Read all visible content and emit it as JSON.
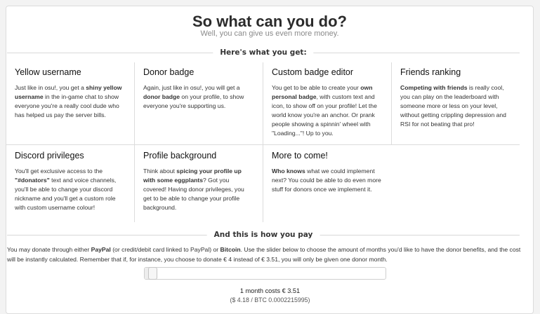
{
  "header": {
    "title": "So what can you do?",
    "subtitle": "Well, you can give us even more money."
  },
  "benefits_divider": "Here's what you get:",
  "benefits": [
    {
      "title": "Yellow username",
      "parts": [
        {
          "t": "Just like in osu!, you get a "
        },
        {
          "t": "shiny yellow username",
          "b": true
        },
        {
          "t": " in the in-game chat to show everyone you're a really cool dude who has helped us pay the server bills."
        }
      ]
    },
    {
      "title": "Donor badge",
      "parts": [
        {
          "t": "Again, just like in osu!, you will get a "
        },
        {
          "t": "donor badge",
          "b": true
        },
        {
          "t": " on your profile, to show everyone you're supporting us."
        }
      ]
    },
    {
      "title": "Custom badge editor",
      "parts": [
        {
          "t": "You get to be able to create your "
        },
        {
          "t": "own personal badge",
          "b": true
        },
        {
          "t": ", with custom text and icon, to show off on your profile! Let the world know you're an anchor. Or prank people showing a spinnin' wheel with \"Loading...\"! Up to you."
        }
      ]
    },
    {
      "title": "Friends ranking",
      "parts": [
        {
          "t": "Competing with friends",
          "b": true
        },
        {
          "t": " is really cool, you can play on the leaderboard with someone more or less on your level, without getting crippling depression and RSI for not beating that pro!"
        }
      ]
    },
    {
      "title": "Discord privileges",
      "parts": [
        {
          "t": "You'll get exclusive access to the "
        },
        {
          "t": "\"#donators\"",
          "b": true
        },
        {
          "t": " text and voice channels, you'll be able to change your discord nickname and you'll get a custom role with custom username colour!"
        }
      ]
    },
    {
      "title": "Profile background",
      "parts": [
        {
          "t": "Think about "
        },
        {
          "t": "spicing your profile up with some eggplants",
          "b": true
        },
        {
          "t": "? Got you covered! Having donor privileges, you get to be able to change your profile background."
        }
      ]
    },
    {
      "title": "More to come!",
      "parts": [
        {
          "t": "Who knows",
          "b": true
        },
        {
          "t": " what we could implement next? You could be able to do even more stuff for donors once we implement it."
        }
      ]
    }
  ],
  "payment_divider": "And this is how you pay",
  "payment": {
    "parts": [
      {
        "t": "You may donate through either "
      },
      {
        "t": "PayPal",
        "b": true
      },
      {
        "t": " (or credit/debit card linked to PayPal) or "
      },
      {
        "t": "Bitcoin",
        "b": true
      },
      {
        "t": ". Use the slider below to choose the amount of months you'd like to have the donor benefits, and the cost will be instantly calculated. Remember that if, for instance, you choose to donate € 4 instead of € 3.51, you will only be given one donor month."
      }
    ],
    "slider_value_fraction": 0.0,
    "cost_label": "1 month costs € 3.51",
    "rate_label": "($ 4.18 / BTC 0.0002215995)"
  },
  "colors": {
    "card_bg": "#ffffff",
    "page_bg": "#f3f3f3",
    "text": "#2b2b2b",
    "muted": "#8a8a8a",
    "border": "#dcdcdc"
  }
}
